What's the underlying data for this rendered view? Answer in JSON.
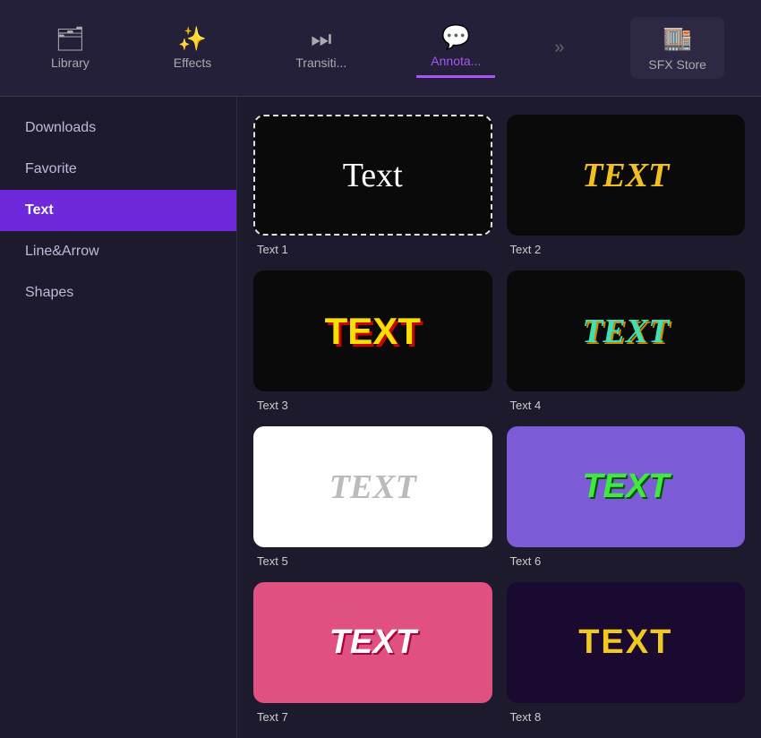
{
  "nav": {
    "items": [
      {
        "id": "library",
        "label": "Library",
        "icon": "🗂"
      },
      {
        "id": "effects",
        "label": "Effects",
        "icon": "✨"
      },
      {
        "id": "transitions",
        "label": "Transiti...",
        "icon": "⏭"
      },
      {
        "id": "annotations",
        "label": "Annota...",
        "icon": "💬",
        "active": true
      },
      {
        "id": "more",
        "label": "",
        "icon": "»"
      },
      {
        "id": "sfx-store",
        "label": "SFX Store",
        "icon": "🏬"
      }
    ]
  },
  "sidebar": {
    "items": [
      {
        "id": "downloads",
        "label": "Downloads"
      },
      {
        "id": "favorite",
        "label": "Favorite"
      },
      {
        "id": "text",
        "label": "Text",
        "active": true
      },
      {
        "id": "line-arrow",
        "label": "Line&Arrow"
      },
      {
        "id": "shapes",
        "label": "Shapes"
      }
    ]
  },
  "content": {
    "items": [
      {
        "id": "text1",
        "label": "Text 1",
        "preview": "Text"
      },
      {
        "id": "text2",
        "label": "Text 2",
        "preview": "TEXT"
      },
      {
        "id": "text3",
        "label": "Text 3",
        "preview": "TEXT"
      },
      {
        "id": "text4",
        "label": "Text 4",
        "preview": "TEXT"
      },
      {
        "id": "text5",
        "label": "Text 5",
        "preview": "TEXT"
      },
      {
        "id": "text6",
        "label": "Text 6",
        "preview": "TEXT"
      },
      {
        "id": "text7",
        "label": "Text 7",
        "preview": "TEXT"
      },
      {
        "id": "text8",
        "label": "Text 8",
        "preview": "TEXT"
      }
    ]
  }
}
